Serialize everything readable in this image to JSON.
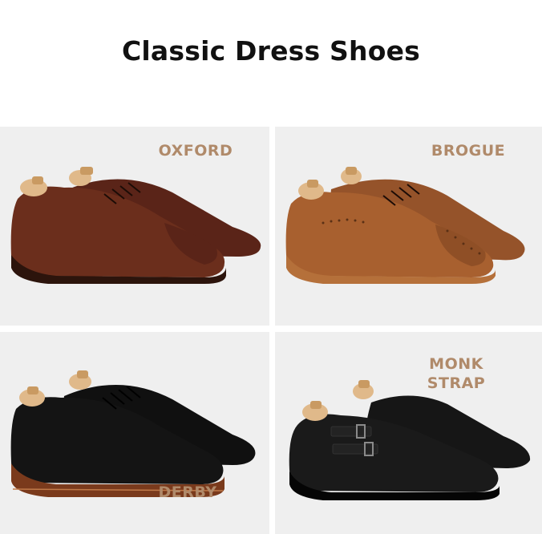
{
  "title": "Classic Dress Shoes",
  "styles": [
    {
      "label": "OXFORD",
      "color": "#6b2e1c"
    },
    {
      "label": "BROGUE",
      "color": "#a8602f"
    },
    {
      "label": "DERBY",
      "color": "#141414"
    },
    {
      "label": "MONK\nSTRAP",
      "color": "#1a1a1a"
    }
  ],
  "colors": {
    "background": "#ffffff",
    "tile": "#efefef",
    "label": "#b08a6a",
    "title": "#111111",
    "shoe_tree": "#e0b98a"
  }
}
